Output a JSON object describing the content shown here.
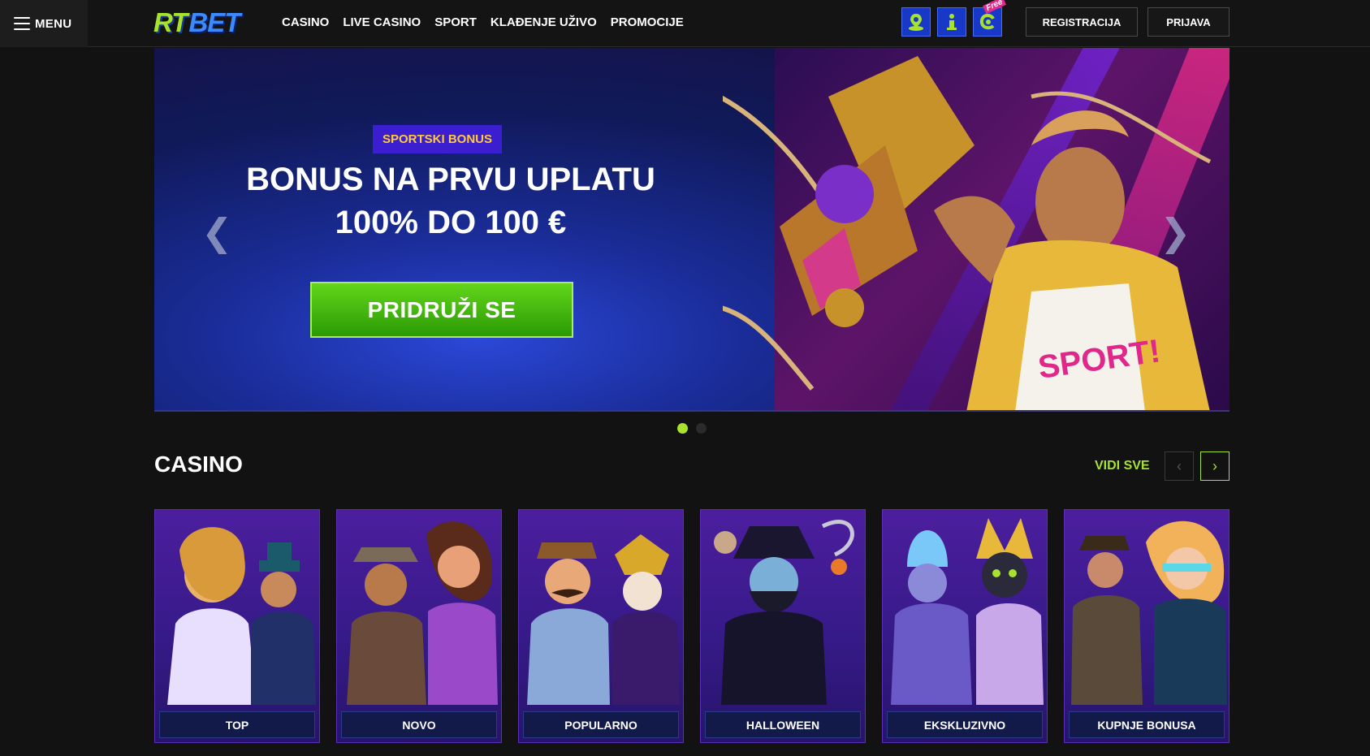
{
  "header": {
    "menu_label": "MENU",
    "logo_rt": "RT",
    "logo_bet": "BET",
    "nav": [
      "CASINO",
      "LIVE CASINO",
      "SPORT",
      "KLAĐENJE UŽIVO",
      "PROMOCIJE"
    ],
    "icons": [
      "map-pin-icon",
      "info-person-icon",
      "free-spin-icon"
    ],
    "free_tag": "Free",
    "register_label": "REGISTRACIJA",
    "login_label": "PRIJAVA"
  },
  "hero": {
    "badge": "SPORTSKI BONUS",
    "headline_line1": "BONUS NA PRVU UPLATU",
    "headline_line2": "100% DO 100 €",
    "cta": "PRIDRUŽI SE",
    "prev_arrow": "❮",
    "next_arrow": "❯",
    "slides_total": 2,
    "active_slide": 1
  },
  "casino": {
    "title": "CASINO",
    "see_all": "VIDI SVE",
    "prev": "‹",
    "next": "›",
    "categories": [
      {
        "label": "TOP"
      },
      {
        "label": "NOVO"
      },
      {
        "label": "POPULARNO"
      },
      {
        "label": "HALLOWEEN"
      },
      {
        "label": "EKSKLUZIVNO"
      },
      {
        "label": "KUPNJE BONUSA"
      }
    ]
  },
  "colors": {
    "accent_green": "#a6e22e",
    "brand_blue": "#1838c8",
    "card_purple": "#4c1e9e",
    "badge_yellow": "#ffcc33"
  }
}
